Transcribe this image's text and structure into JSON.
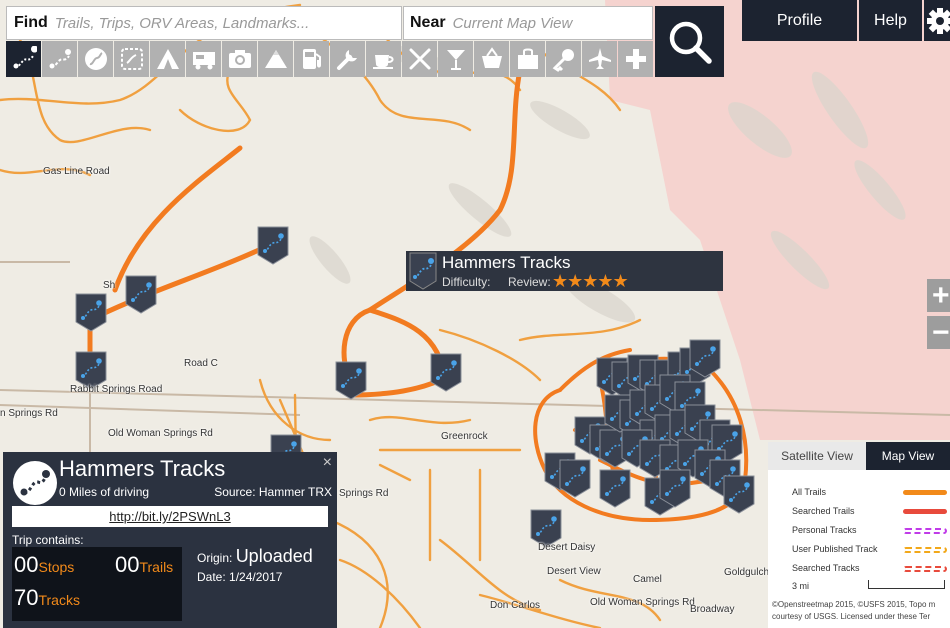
{
  "search": {
    "find_label": "Find",
    "find_placeholder": "Trails, Trips, ORV Areas, Landmarks...",
    "near_label": "Near",
    "near_placeholder": "Current Map View",
    "search_icon": "magnifier-icon"
  },
  "toolbar": {
    "icons": [
      "track-icon",
      "trail-icon",
      "trip-icon",
      "area-icon",
      "camping-icon",
      "rv-icon",
      "camera-icon",
      "mountain-icon",
      "fuel-icon",
      "repair-icon",
      "cafe-icon",
      "restaurant-icon",
      "bar-icon",
      "shopping-icon",
      "store-icon",
      "lodging-icon",
      "airport-icon",
      "medical-icon"
    ]
  },
  "header": {
    "profile_label": "Profile",
    "help_label": "Help",
    "gear_icon": "gear-icon"
  },
  "zoom": {
    "in_label": "+",
    "out_label": "−"
  },
  "map": {
    "labels": {
      "gas_line_road": "Gas Line Road",
      "road_c": "Road C",
      "rabbit_springs_road": "Rabbit Springs Road",
      "springs_rd_left": "n Springs Rd",
      "old_woman_springs_rd": "Old Woman Springs Rd",
      "greenrock": "Greenrock",
      "springs_rd_mid": "Springs Rd",
      "desert_daisy": "Desert Daisy",
      "desert_view": "Desert View",
      "camel": "Camel",
      "old_woman_springs_rd_2": "Old Woman Springs Rd",
      "don_carlos": "Don Carlos",
      "broadway": "Broadway",
      "goldgulch": "Goldgulch",
      "sh": "Sh"
    },
    "colors": {
      "trail": "#f28a1a",
      "private": "#f5d3cf",
      "marker": "#3a4150"
    }
  },
  "tooltip": {
    "title": "Hammers Tracks",
    "difficulty_label": "Difficulty:",
    "review_label": "Review:",
    "stars": "★★★★★"
  },
  "panel": {
    "title": "Hammers Tracks",
    "miles": "0 Miles of driving",
    "source": "Source: Hammer TRX",
    "link": "http://bit.ly/2PSWnL3",
    "contains_label": "Trip contains:",
    "stops_num": "00",
    "stops_label": "Stops",
    "trails_num": "00",
    "trails_label": "Trails",
    "tracks_num": "70",
    "tracks_label": "Tracks",
    "origin_label": "Origin:",
    "origin_value": "Uploaded",
    "date_label": "Date:",
    "date_value": "1/24/2017",
    "close_glyph": "×"
  },
  "legend": {
    "tab_satellite": "Satellite View",
    "tab_map": "Map View",
    "rows": [
      {
        "label": "All Trails",
        "color": "#f28a1a"
      },
      {
        "label": "Searched Trails",
        "color": "#e84a3c"
      },
      {
        "label": "Personal Tracks",
        "color": "#c03ce8"
      },
      {
        "label": "User Published Track",
        "color": "#f2a81a"
      },
      {
        "label": "Searched Tracks",
        "color": "#e84a3c"
      }
    ],
    "scale": "3 mi",
    "attribution_1": "©Openstreetmap 2015, ©USFS 2015, Topo m",
    "attribution_2": "courtesy of USGS. Licensed under these Ter"
  }
}
